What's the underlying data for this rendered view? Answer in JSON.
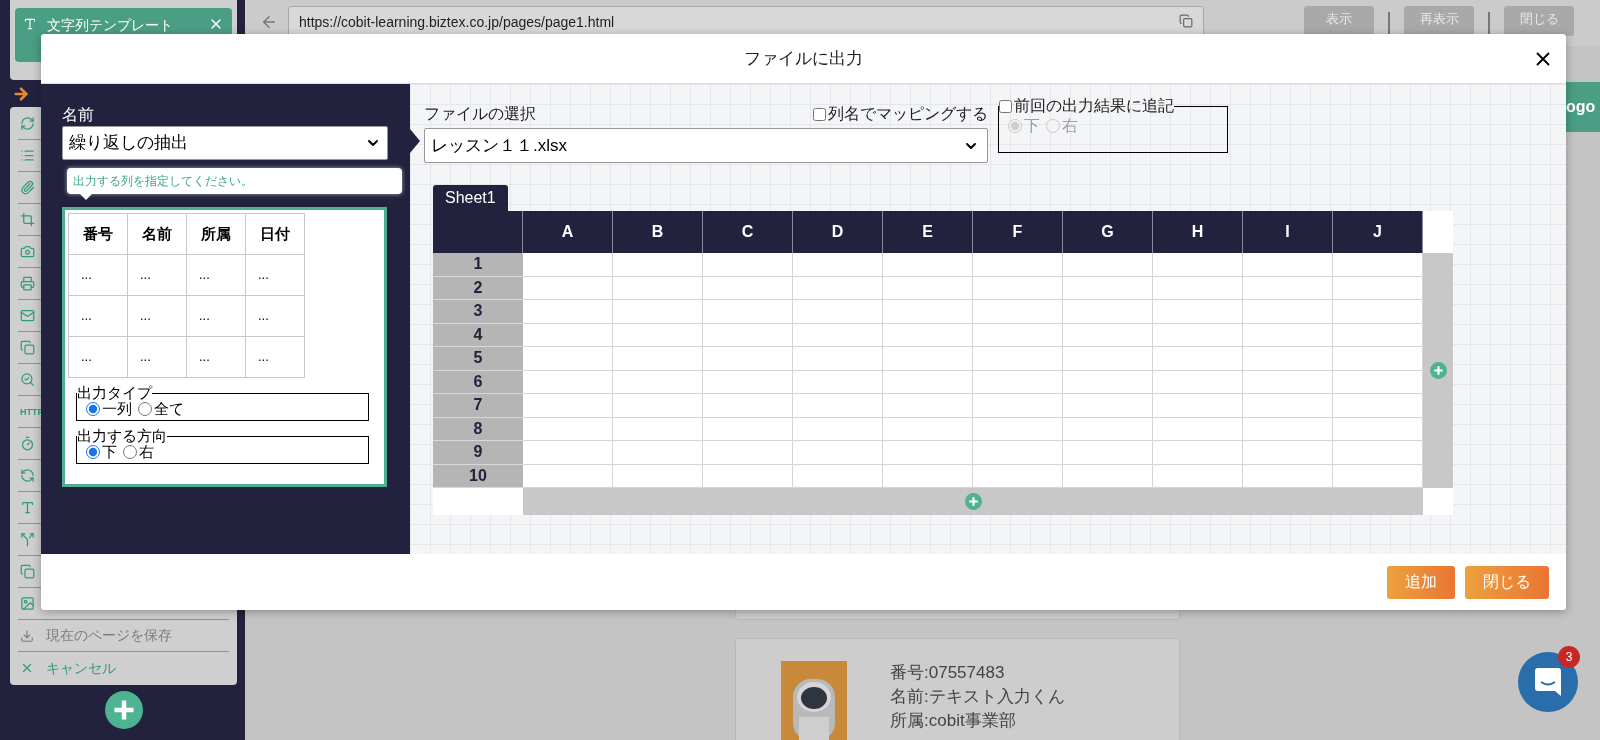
{
  "sidebar": {
    "template_card": {
      "title": "文字列テンプレート"
    },
    "tool_text_label": "HTTP",
    "bottom_items": [
      {
        "label": "現在のページを保存",
        "disabled": true
      },
      {
        "label": "キャンセル",
        "disabled": false
      }
    ]
  },
  "browser_bar": {
    "url": "https://cobit-learning.biztex.co.jp/pages/page1.html",
    "buttons": [
      {
        "label": "表示"
      },
      {
        "label": "再表示"
      },
      {
        "label": "閉じる"
      }
    ]
  },
  "page": {
    "logo_fragment": "ogo",
    "profile_card": {
      "lines": [
        "番号:07557483",
        "名前:テキスト入力くん",
        "所属:cobit事業部"
      ]
    }
  },
  "chat": {
    "badge": "3"
  },
  "dialog": {
    "title": "ファイルに出力",
    "left": {
      "name_label": "名前",
      "name_value": "繰り返しの抽出",
      "tooltip": "出力する列を指定してください。",
      "preview": {
        "columns": [
          "番号",
          "名前",
          "所属",
          "日付"
        ],
        "rows": [
          [
            "...",
            "...",
            "...",
            "..."
          ],
          [
            "...",
            "...",
            "...",
            "..."
          ],
          [
            "...",
            "...",
            "...",
            "..."
          ]
        ]
      },
      "output_type": {
        "legend": "出力タイプ",
        "options": [
          {
            "label": "一列",
            "selected": true
          },
          {
            "label": "全て",
            "selected": false
          }
        ]
      },
      "direction": {
        "legend": "出力する方向",
        "options": [
          {
            "label": "下",
            "selected": true
          },
          {
            "label": "右",
            "selected": false
          }
        ]
      }
    },
    "right": {
      "file_label": "ファイルの選択",
      "file_value": "レッスン１１.xlsx",
      "map_by_column": {
        "label": "列名でマッピングする",
        "checked": false
      },
      "append": {
        "label": "前回の出力結果に追記",
        "checked": false,
        "options": [
          {
            "label": "下",
            "selected": true,
            "disabled": true
          },
          {
            "label": "右",
            "selected": false,
            "disabled": true
          }
        ]
      },
      "sheet_tab": "Sheet1",
      "columns": [
        "A",
        "B",
        "C",
        "D",
        "E",
        "F",
        "G",
        "H",
        "I",
        "J"
      ],
      "rows": [
        "1",
        "2",
        "3",
        "4",
        "5",
        "6",
        "7",
        "8",
        "9",
        "10"
      ]
    },
    "buttons": [
      {
        "label": "追加"
      },
      {
        "label": "閉じる"
      }
    ]
  }
}
